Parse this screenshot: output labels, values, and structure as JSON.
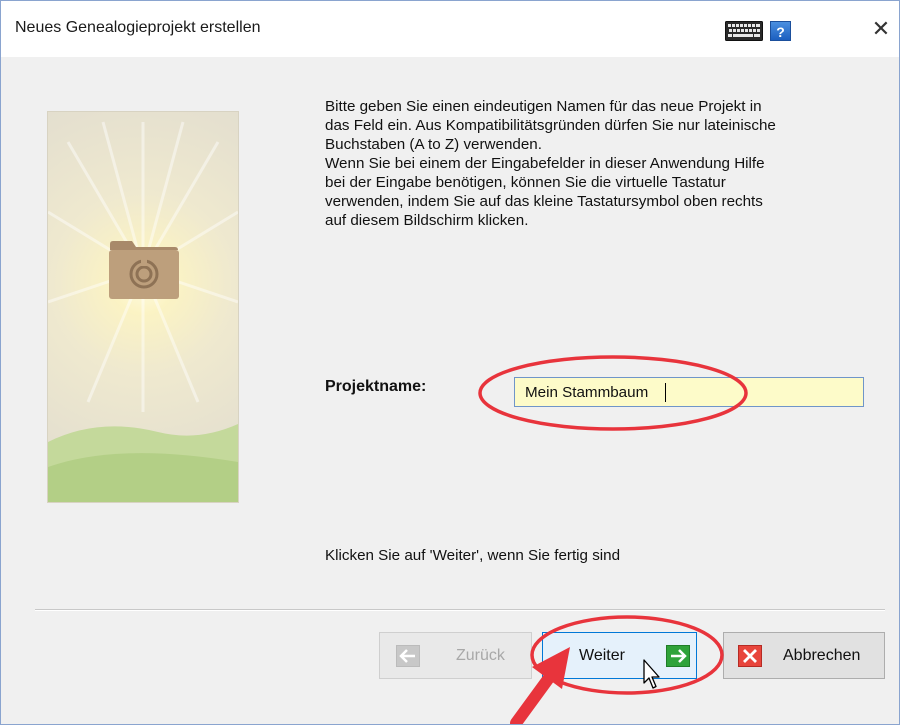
{
  "window": {
    "title": "Neues Genealogieprojekt erstellen",
    "help_label": "?",
    "close_label": "✕"
  },
  "instructions": "Bitte geben Sie einen eindeutigen Namen für das neue Projekt in\ndas Feld ein. Aus Kompatibilitätsgründen dürfen Sie nur lateinische\nBuchstaben (A to Z) verwenden.\nWenn Sie bei einem der Eingabefelder in dieser Anwendung Hilfe\nbei der Eingabe benötigen, können Sie die virtuelle Tastatur\nverwenden, indem Sie auf das kleine Tastatursymbol oben rechts\nauf diesem Bildschirm klicken.",
  "project_name": {
    "label": "Projektname:",
    "value": "Mein Stammbaum"
  },
  "hint": "Klicken Sie auf 'Weiter', wenn Sie fertig sind",
  "buttons": {
    "back": "Zurück",
    "next": "Weiter",
    "cancel": "Abbrechen"
  },
  "colors": {
    "input_background": "#fdfbc9",
    "annotation_red": "#e8343c",
    "next_icon_green": "#2fa33a",
    "cancel_icon_red": "#e8453c"
  },
  "icons": {
    "keyboard": "keyboard-icon",
    "help": "help-icon",
    "close": "close-icon",
    "folder": "folder-icon",
    "back": "arrow-left-icon",
    "next": "arrow-right-icon",
    "cancel": "x-icon",
    "cursor": "mouse-cursor-icon"
  }
}
